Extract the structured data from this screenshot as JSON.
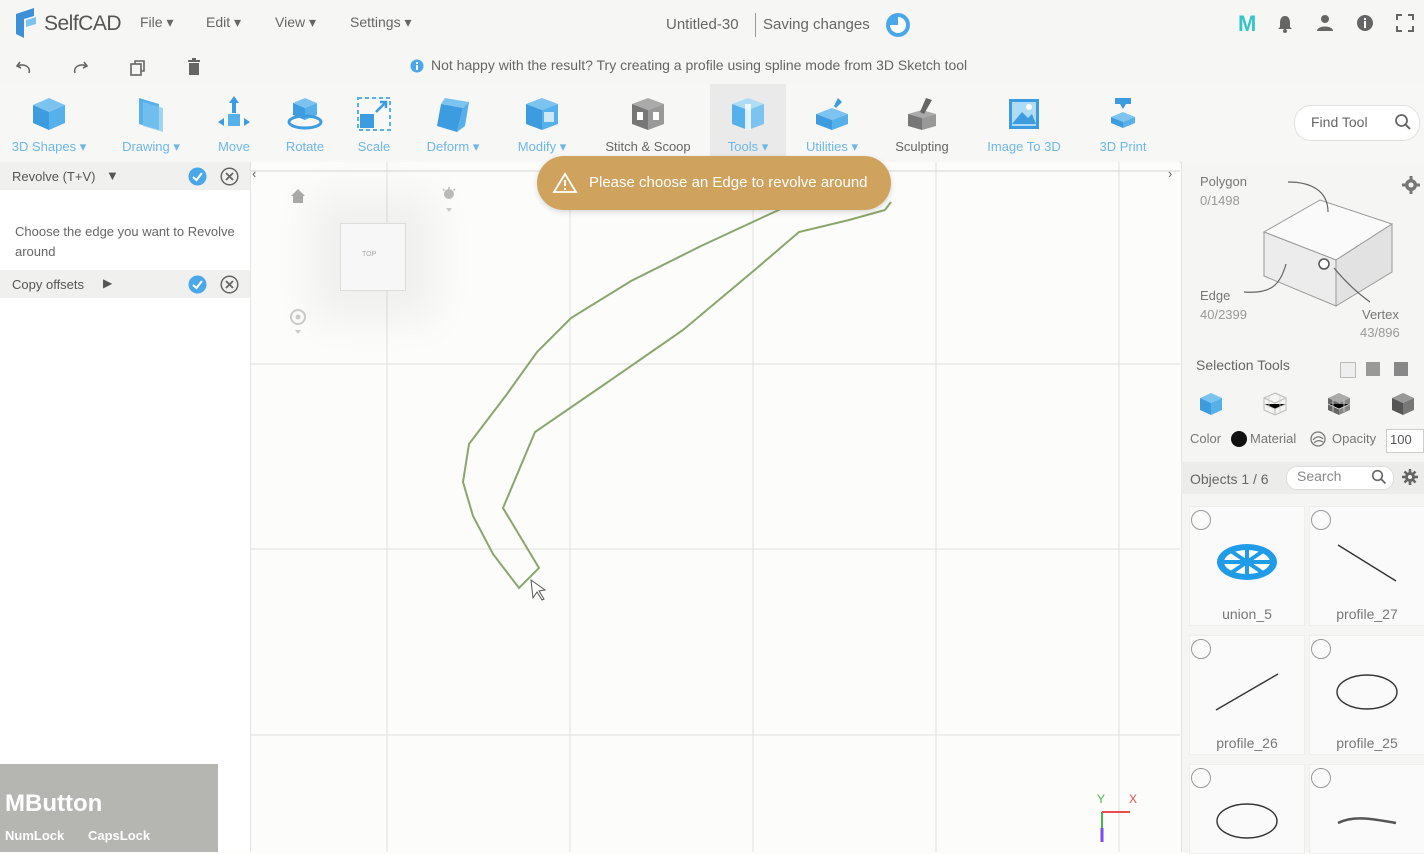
{
  "app": {
    "name": "SelfCAD"
  },
  "menu": {
    "file": "File",
    "edit": "Edit",
    "view": "View",
    "settings": "Settings"
  },
  "document": {
    "title": "Untitled-30",
    "status": "Saving changes"
  },
  "hint": {
    "text": "Not happy with the result? Try creating a profile using spline mode from 3D Sketch tool"
  },
  "toolbar": {
    "shapes": "3D Shapes",
    "drawing": "Drawing",
    "move": "Move",
    "rotate": "Rotate",
    "scale": "Scale",
    "deform": "Deform",
    "modify": "Modify",
    "stitch": "Stitch & Scoop",
    "tools": "Tools",
    "utilities": "Utilities",
    "sculpting": "Sculpting",
    "image3d": "Image To 3D",
    "print": "3D Print",
    "find": "Find Tool"
  },
  "left_panel": {
    "revolve_title": "Revolve (T+V)",
    "revolve_desc": "Choose the edge you want to Revolve around",
    "copy_title": "Copy offsets"
  },
  "overlay": {
    "title": "MButton",
    "numlock": "NumLock",
    "capslock": "CapsLock"
  },
  "toast": {
    "text": "Please choose an Edge to revolve around"
  },
  "viewcube": {
    "label": "TOP"
  },
  "axes": {
    "y": "Y",
    "x": "X"
  },
  "right_panel": {
    "polygon_label": "Polygon",
    "polygon_count": "0/1498",
    "edge_label": "Edge",
    "edge_count": "40/2399",
    "vertex_label": "Vertex",
    "vertex_count": "43/896",
    "selection_tools": "Selection Tools",
    "color_label": "Color",
    "material_label": "Material",
    "opacity_label": "Opacity",
    "opacity_value": "100",
    "objects_count": "Objects 1 / 6",
    "search_placeholder": "Search",
    "objects": [
      {
        "name": "union_5"
      },
      {
        "name": "profile_27"
      },
      {
        "name": "profile_26"
      },
      {
        "name": "profile_25"
      }
    ]
  },
  "colors": {
    "accent": "#4aa8e8",
    "toast_bg": "#cfa25e",
    "sketch_line": "#8aa66e"
  }
}
